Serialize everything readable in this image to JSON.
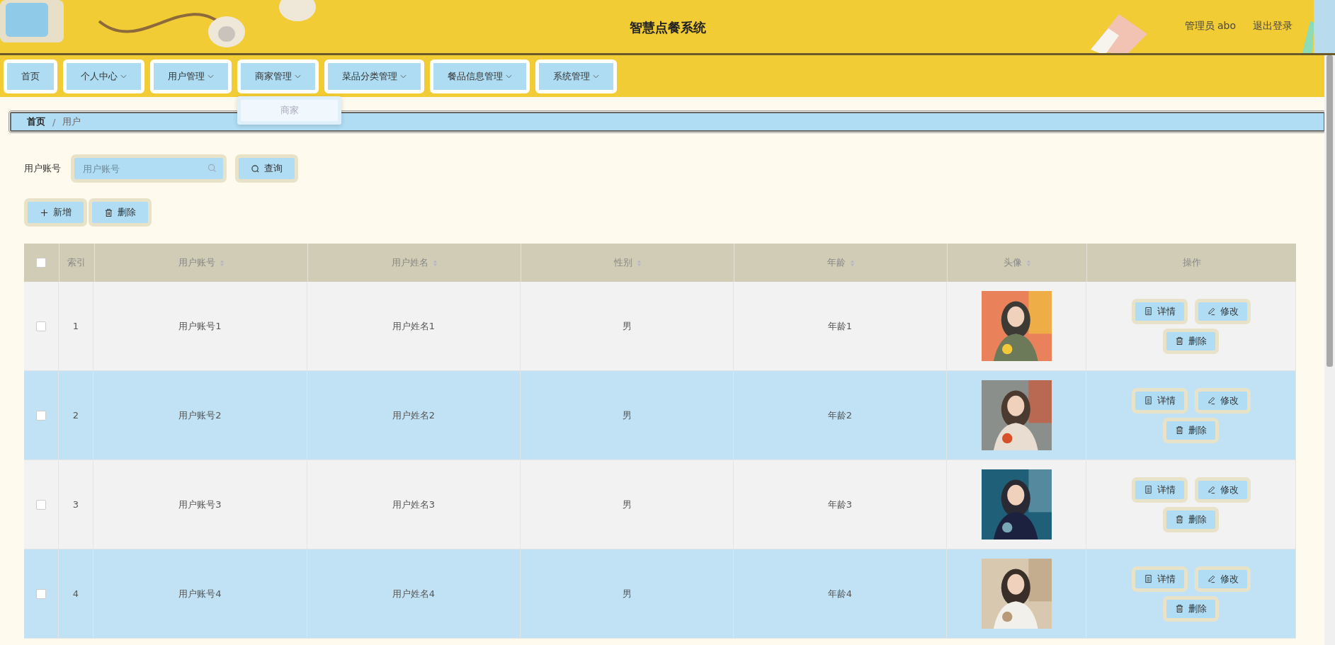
{
  "header": {
    "title": "智慧点餐系统",
    "user": "管理员 abo",
    "logout": "退出登录"
  },
  "nav": [
    {
      "label": "首页",
      "has_menu": false
    },
    {
      "label": "个人中心",
      "has_menu": true
    },
    {
      "label": "用户管理",
      "has_menu": true
    },
    {
      "label": "商家管理",
      "has_menu": true,
      "menu": [
        "商家"
      ]
    },
    {
      "label": "菜品分类管理",
      "has_menu": true
    },
    {
      "label": "餐品信息管理",
      "has_menu": true
    },
    {
      "label": "系统管理",
      "has_menu": true
    }
  ],
  "breadcrumb": [
    "首页",
    "用户"
  ],
  "breadcrumb_separator": "/",
  "search": {
    "label": "用户账号",
    "placeholder": "用户账号",
    "button": "查询"
  },
  "actions": [
    {
      "kind": "add",
      "label": "新增"
    },
    {
      "kind": "delete",
      "label": "删除"
    }
  ],
  "table": {
    "select_all": {
      "checked": false
    },
    "columns": [
      {
        "label": "索引",
        "sortable": false
      },
      {
        "label": "用户账号",
        "sortable": true
      },
      {
        "label": "用户姓名",
        "sortable": true
      },
      {
        "label": "性别",
        "sortable": true
      },
      {
        "label": "年龄",
        "sortable": true
      },
      {
        "label": "头像",
        "sortable": true
      },
      {
        "label": "操作",
        "sortable": false
      }
    ],
    "rows": [
      {
        "checked": false,
        "index": "1",
        "account": "用户账号1",
        "name": "用户姓名1",
        "gender": "男",
        "age": "年龄1",
        "actions": [
          {
            "kind": "detail",
            "label": "详情"
          },
          {
            "kind": "edit",
            "label": "修改"
          },
          {
            "kind": "delete",
            "label": "删除"
          }
        ]
      },
      {
        "checked": false,
        "index": "2",
        "account": "用户账号2",
        "name": "用户姓名2",
        "gender": "男",
        "age": "年龄2",
        "actions": [
          {
            "kind": "detail",
            "label": "详情"
          },
          {
            "kind": "edit",
            "label": "修改"
          },
          {
            "kind": "delete",
            "label": "删除"
          }
        ]
      },
      {
        "checked": false,
        "index": "3",
        "account": "用户账号3",
        "name": "用户姓名3",
        "gender": "男",
        "age": "年龄3",
        "actions": [
          {
            "kind": "detail",
            "label": "详情"
          },
          {
            "kind": "edit",
            "label": "修改"
          },
          {
            "kind": "delete",
            "label": "删除"
          }
        ]
      },
      {
        "checked": false,
        "index": "4",
        "account": "用户账号4",
        "name": "用户姓名4",
        "gender": "男",
        "age": "年龄4",
        "actions": [
          {
            "kind": "detail",
            "label": "详情"
          },
          {
            "kind": "edit",
            "label": "修改"
          },
          {
            "kind": "delete",
            "label": "删除"
          }
        ]
      }
    ]
  }
}
